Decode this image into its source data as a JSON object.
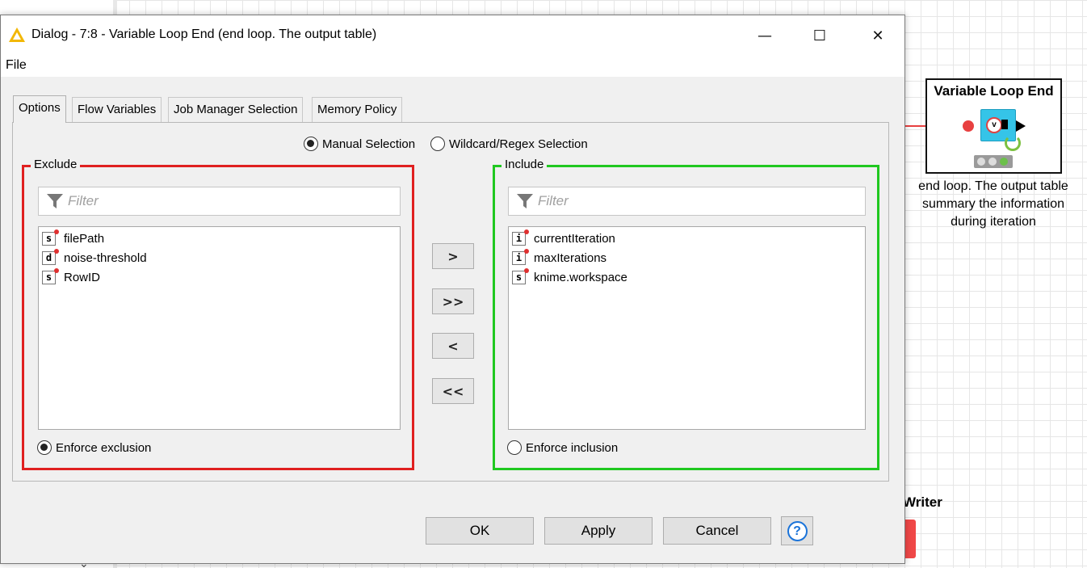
{
  "dialog": {
    "title": "Dialog - 7:8 - Variable Loop End (end loop. The output table)",
    "window_controls": {
      "minimize": "—",
      "maximize": "☐",
      "close": "✕"
    },
    "menu": {
      "file": "File"
    },
    "tabs": [
      "Options",
      "Flow Variables",
      "Job Manager Selection",
      "Memory Policy"
    ],
    "active_tab": "Options",
    "selection_mode": {
      "manual_label": "Manual Selection",
      "wildcard_label": "Wildcard/Regex Selection",
      "selected": "manual"
    },
    "exclude": {
      "legend": "Exclude",
      "filter_placeholder": "Filter",
      "items": [
        {
          "type": "s",
          "name": "filePath"
        },
        {
          "type": "d",
          "name": "noise-threshold"
        },
        {
          "type": "s",
          "name": "RowID"
        }
      ],
      "enforce_label": "Enforce exclusion",
      "enforce_checked": true
    },
    "include": {
      "legend": "Include",
      "filter_placeholder": "Filter",
      "items": [
        {
          "type": "i",
          "name": "currentIteration"
        },
        {
          "type": "i",
          "name": "maxIterations"
        },
        {
          "type": "s",
          "name": "knime.workspace"
        }
      ],
      "enforce_label": "Enforce inclusion",
      "enforce_checked": false
    },
    "move_buttons": {
      "add": ">",
      "add_all": ">>",
      "remove": "<",
      "remove_all": "<<"
    },
    "buttons": {
      "ok": "OK",
      "apply": "Apply",
      "cancel": "Cancel",
      "help": "?"
    },
    "colors": {
      "exclude_border": "#e02020",
      "include_border": "#20c820"
    }
  },
  "workflow": {
    "node_title": "Variable Loop End",
    "node_icon_label": "v",
    "node_description": [
      "end loop. The output table",
      "summary the information",
      "during iteration"
    ],
    "writer_label": "Writer"
  }
}
